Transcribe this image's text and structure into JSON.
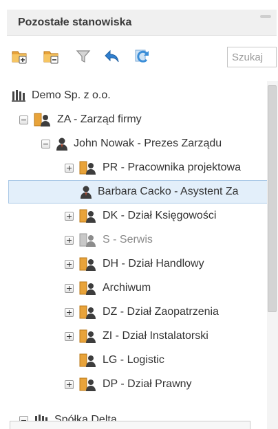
{
  "panel": {
    "title": "Pozostałe stanowiska"
  },
  "toolbar": {
    "buttons": [
      {
        "name": "add-folder-icon"
      },
      {
        "name": "remove-folder-icon"
      },
      {
        "name": "filter-icon"
      },
      {
        "name": "undo-icon"
      },
      {
        "name": "refresh-icon"
      }
    ],
    "search_placeholder": "Szukaj"
  },
  "tree": {
    "nodes": [
      {
        "label": "Demo Sp. z o.o.",
        "icon": "company-icon"
      },
      {
        "label": "ZA - Zarząd firmy",
        "icon": "department-icon",
        "toggle": "minus"
      },
      {
        "label": "John Nowak - Prezes Zarządu",
        "icon": "person-icon",
        "toggle": "minus"
      },
      {
        "label": "PR - Pracownika projektowa",
        "icon": "department-icon",
        "toggle": "plus"
      },
      {
        "label": "Barbara Cacko - Asystent Za",
        "icon": "person-icon",
        "selected": true
      },
      {
        "label": "DK - Dział Księgowości",
        "icon": "department-icon",
        "toggle": "plus"
      },
      {
        "label": "S - Serwis",
        "icon": "department-icon-gray",
        "toggle": "plus",
        "muted": true
      },
      {
        "label": "DH - Dział Handlowy",
        "icon": "department-icon",
        "toggle": "plus"
      },
      {
        "label": "Archiwum",
        "icon": "department-icon",
        "toggle": "plus"
      },
      {
        "label": "DZ - Dział Zaopatrzenia",
        "icon": "department-icon",
        "toggle": "plus"
      },
      {
        "label": "ZI - Dział Instalatorski",
        "icon": "department-icon",
        "toggle": "plus"
      },
      {
        "label": "LG - Logistic",
        "icon": "department-icon"
      },
      {
        "label": "DP - Dział Prawny",
        "icon": "department-icon",
        "toggle": "plus"
      },
      {
        "label": "Spółka Delta",
        "icon": "company-icon",
        "toggle": "minus"
      }
    ]
  },
  "colors": {
    "folder": "#e8a33a",
    "person": "#3d3d3d",
    "selected_bg": "#e3effa",
    "refresh": "#3b8ed8"
  }
}
